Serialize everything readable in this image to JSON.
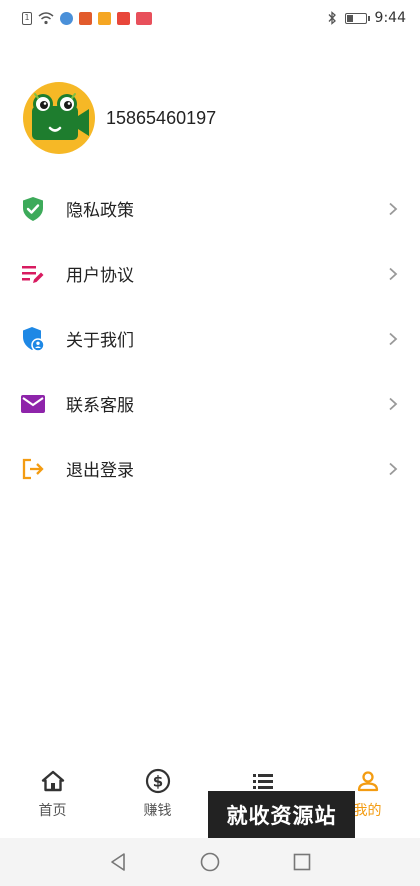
{
  "status_bar": {
    "time": "9:44",
    "icons": [
      "sim-icon",
      "wifi-icon",
      "app-icon-1",
      "app-icon-2",
      "app-icon-3",
      "app-icon-4",
      "app-icon-5",
      "bluetooth-icon",
      "battery-icon"
    ]
  },
  "profile": {
    "phone": "15865460197",
    "avatar_color": "#f6b826"
  },
  "menu": {
    "items": [
      {
        "label": "隐私政策",
        "icon": "shield-check-icon",
        "color": "#3daa5a"
      },
      {
        "label": "用户协议",
        "icon": "list-edit-icon",
        "color": "#d81b60"
      },
      {
        "label": "关于我们",
        "icon": "shield-user-icon",
        "color": "#1e88e5"
      },
      {
        "label": "联系客服",
        "icon": "mail-icon",
        "color": "#8e24aa"
      },
      {
        "label": "退出登录",
        "icon": "logout-icon",
        "color": "#f39c12"
      }
    ]
  },
  "tabbar": {
    "items": [
      {
        "label": "首页",
        "icon": "home-icon"
      },
      {
        "label": "赚钱",
        "icon": "dollar-coin-icon"
      },
      {
        "label": "",
        "icon": "list-icon"
      },
      {
        "label": "我的",
        "icon": "user-icon",
        "active": true
      }
    ],
    "active_color": "#f39c12"
  },
  "watermark": "就收资源站"
}
